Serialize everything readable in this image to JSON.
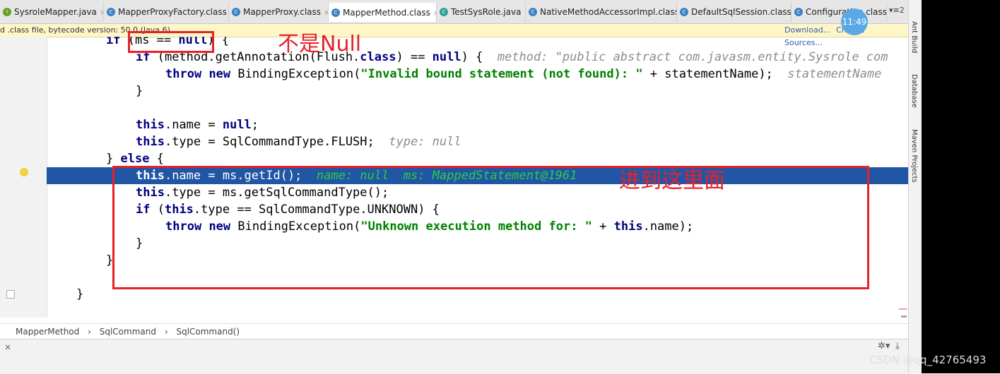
{
  "tabs": [
    {
      "label": "SysroleMapper.java",
      "icon": "I",
      "kind": "i",
      "active": false
    },
    {
      "label": "MapperProxyFactory.class",
      "icon": "C",
      "kind": "c",
      "active": false
    },
    {
      "label": "MapperProxy.class",
      "icon": "C",
      "kind": "c",
      "active": false
    },
    {
      "label": "MapperMethod.class",
      "icon": "C",
      "kind": "c",
      "active": true
    },
    {
      "label": "TestSysRole.java",
      "icon": "C",
      "kind": "t",
      "active": false
    },
    {
      "label": "NativeMethodAccessorImpl.class",
      "icon": "C",
      "kind": "c",
      "active": false
    },
    {
      "label": "DefaultSqlSession.class",
      "icon": "C",
      "kind": "c",
      "active": false
    },
    {
      "label": "Configuration.class",
      "icon": "C",
      "kind": "c",
      "active": false
    }
  ],
  "tab_menu": "▾≡2",
  "close_glyph": "×",
  "infobar": {
    "text": "d .class file, bytecode version: 50.0 (Java 6)",
    "download": "Download...",
    "choose": "Choose Sources..."
  },
  "code": {
    "l1_kw": "if",
    "l1_b": " (ms == ",
    "l1_null": "null",
    "l1_c": ") {",
    "l2_if": "if",
    "l2_a": " (method.getAnnotation(Flush.",
    "l2_class": "class",
    "l2_b": ") == ",
    "l2_null": "null",
    "l2_c": ") {  ",
    "l2_hint": "method: \"public abstract com.javasm.entity.Sysrole com",
    "l3_throw": "throw",
    "l3_new": "new",
    "l3_a": " BindingException(",
    "l3_str": "\"Invalid bound statement (not found): \"",
    "l3_b": " + statementName);  ",
    "l3_hint": "statementName",
    "l4": "}",
    "l6_this": "this",
    "l6_a": ".name = ",
    "l6_null": "null",
    "l6_b": ";",
    "l7_this": "this",
    "l7_a": ".type = SqlCommandType.FLUSH;  ",
    "l7_hint": "type: null",
    "l8_a": "} ",
    "l8_else": "else",
    "l8_b": " {",
    "l9_this": "this",
    "l9_a": ".name = ms.getId();  ",
    "l9_hint": "name: null  ms: MappedStatement@1961",
    "l10_this": "this",
    "l10_a": ".type = ms.getSqlCommandType();",
    "l11_if": "if",
    "l11_a": " (",
    "l11_this": "this",
    "l11_b": ".type == SqlCommandType.UNKNOWN) {",
    "l12_throw": "throw",
    "l12_new": "new",
    "l12_a": " BindingException(",
    "l12_str": "\"Unknown execution method for: \"",
    "l12_b": " + ",
    "l12_this": "this",
    "l12_c": ".name);",
    "l13": "}",
    "l14": "}",
    "l16": "}"
  },
  "breadcrumb": [
    "MapperMethod",
    "›",
    "SqlCommand",
    "›",
    "SqlCommand()"
  ],
  "right_tools": [
    "Ant Build",
    "Database",
    "Maven Projects"
  ],
  "clock": "11:49",
  "annotations": {
    "top": "不是Null",
    "main": "进到这里面"
  },
  "watermark": "CSDN @qq_42765493",
  "bottom_icons": {
    "settings": "✲▾",
    "download": "⤓"
  },
  "colors": {
    "highlight": "#2156a5",
    "annotation": "#e8202a",
    "keyword": "#000080",
    "string": "#008000"
  }
}
